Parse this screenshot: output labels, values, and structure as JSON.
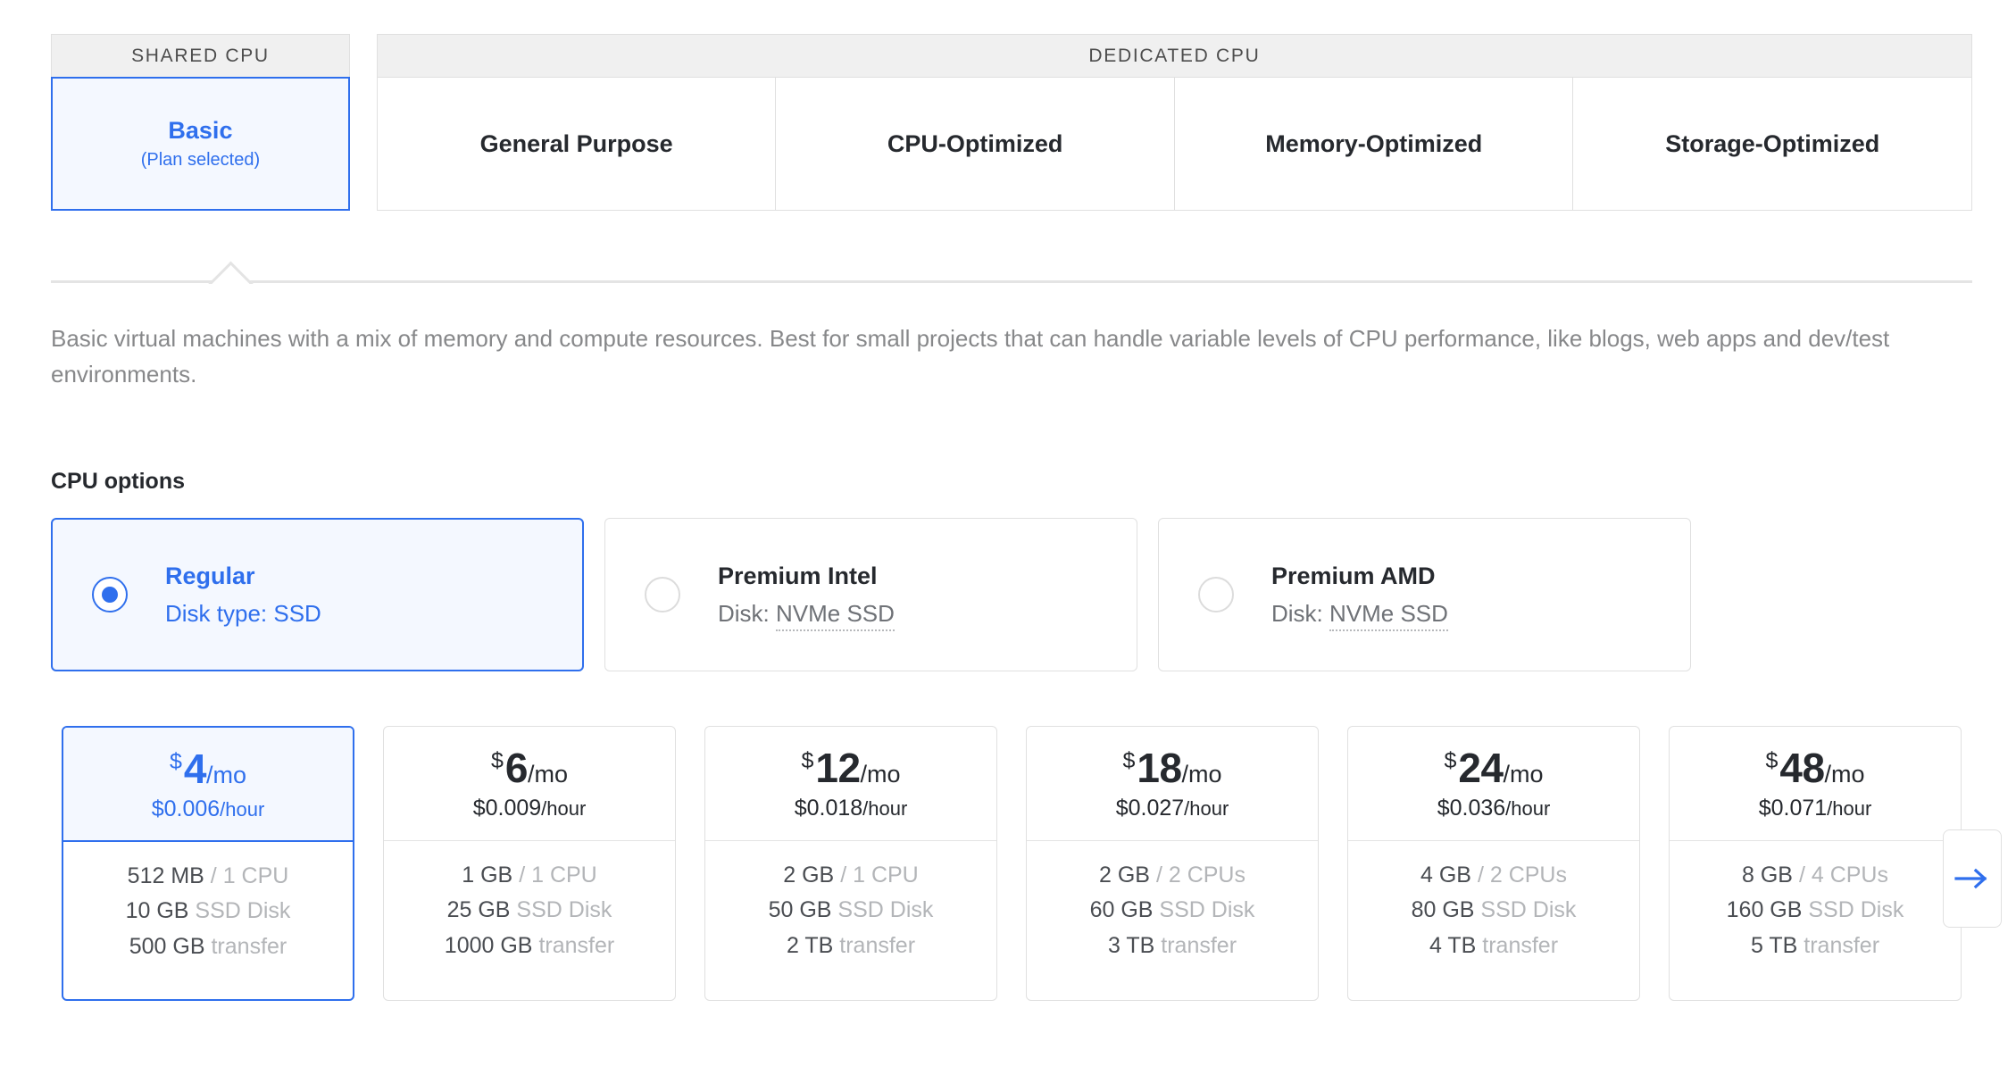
{
  "accent_color": "#2f6fed",
  "tab_groups": [
    {
      "header": "SHARED CPU",
      "tabs": [
        {
          "title": "Basic",
          "sub": "(Plan selected)",
          "selected": true
        }
      ]
    },
    {
      "header": "DEDICATED CPU",
      "tabs": [
        {
          "title": "General Purpose",
          "sub": "",
          "selected": false
        },
        {
          "title": "CPU-Optimized",
          "sub": "",
          "selected": false
        },
        {
          "title": "Memory-Optimized",
          "sub": "",
          "selected": false
        },
        {
          "title": "Storage-Optimized",
          "sub": "",
          "selected": false
        }
      ]
    }
  ],
  "description": "Basic virtual machines with a mix of memory and compute resources. Best for small projects that can handle variable levels of CPU performance, like blogs, web apps and dev/test environments.",
  "cpu_options": {
    "title": "CPU options",
    "items": [
      {
        "name": "Regular",
        "disk_label": "Disk type: SSD",
        "disk_prefix": "Disk type: SSD",
        "disk_value": "",
        "selected": true
      },
      {
        "name": "Premium Intel",
        "disk_label": "Disk: NVMe SSD",
        "disk_prefix": "Disk: ",
        "disk_value": "NVMe SSD",
        "selected": false
      },
      {
        "name": "Premium AMD",
        "disk_label": "Disk: NVMe SSD",
        "disk_prefix": "Disk: ",
        "disk_value": "NVMe SSD",
        "selected": false
      }
    ]
  },
  "plans": [
    {
      "currency": "$",
      "amount": "4",
      "period": "/mo",
      "hourly_price": "$0.006",
      "hourly_unit": "/hour",
      "memory": "512 MB",
      "cpu": "/ 1 CPU",
      "disk": "10 GB",
      "disk_label": "SSD Disk",
      "transfer": "500 GB",
      "transfer_label": "transfer",
      "selected": true
    },
    {
      "currency": "$",
      "amount": "6",
      "period": "/mo",
      "hourly_price": "$0.009",
      "hourly_unit": "/hour",
      "memory": "1 GB",
      "cpu": "/ 1 CPU",
      "disk": "25 GB",
      "disk_label": "SSD Disk",
      "transfer": "1000 GB",
      "transfer_label": "transfer",
      "selected": false
    },
    {
      "currency": "$",
      "amount": "12",
      "period": "/mo",
      "hourly_price": "$0.018",
      "hourly_unit": "/hour",
      "memory": "2 GB",
      "cpu": "/ 1 CPU",
      "disk": "50 GB",
      "disk_label": "SSD Disk",
      "transfer": "2 TB",
      "transfer_label": "transfer",
      "selected": false
    },
    {
      "currency": "$",
      "amount": "18",
      "period": "/mo",
      "hourly_price": "$0.027",
      "hourly_unit": "/hour",
      "memory": "2 GB",
      "cpu": "/ 2 CPUs",
      "disk": "60 GB",
      "disk_label": "SSD Disk",
      "transfer": "3 TB",
      "transfer_label": "transfer",
      "selected": false
    },
    {
      "currency": "$",
      "amount": "24",
      "period": "/mo",
      "hourly_price": "$0.036",
      "hourly_unit": "/hour",
      "memory": "4 GB",
      "cpu": "/ 2 CPUs",
      "disk": "80 GB",
      "disk_label": "SSD Disk",
      "transfer": "4 TB",
      "transfer_label": "transfer",
      "selected": false
    },
    {
      "currency": "$",
      "amount": "48",
      "period": "/mo",
      "hourly_price": "$0.071",
      "hourly_unit": "/hour",
      "memory": "8 GB",
      "cpu": "/ 4 CPUs",
      "disk": "160 GB",
      "disk_label": "SSD Disk",
      "transfer": "5 TB",
      "transfer_label": "transfer",
      "selected": false
    }
  ],
  "next_button": {
    "icon": "arrow-right-icon"
  }
}
